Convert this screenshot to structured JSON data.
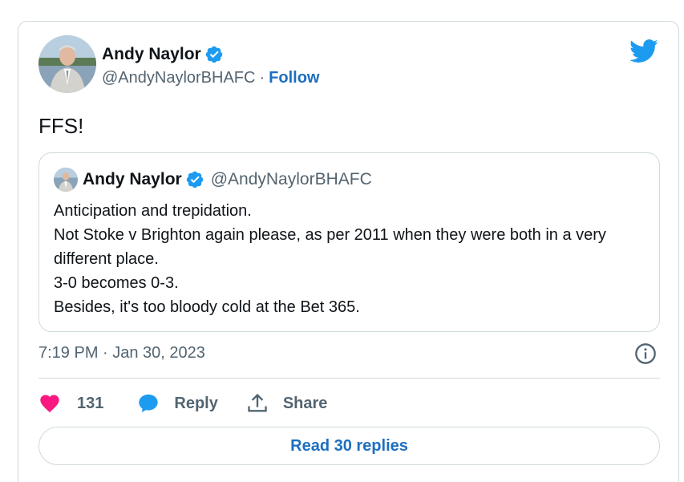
{
  "author": {
    "name": "Andy Naylor",
    "handle": "@AndyNaylorBHAFC",
    "separator": "·",
    "follow_label": "Follow"
  },
  "tweet": {
    "text": "FFS!",
    "timestamp": "7:19 PM · Jan 30, 2023"
  },
  "quoted_tweet": {
    "name": "Andy Naylor",
    "handle": "@AndyNaylorBHAFC",
    "lines": [
      "Anticipation and trepidation.",
      "Not Stoke v Brighton again please, as per 2011 when they were both in a very different place.",
      "3-0 becomes 0-3.",
      "Besides, it's too bloody cold at the Bet 365."
    ]
  },
  "actions": {
    "like_count": "131",
    "reply_label": "Reply",
    "share_label": "Share"
  },
  "read_replies_label": "Read 30 replies",
  "colors": {
    "accent": "#1d9bf0",
    "link": "#1d6fbf",
    "like": "#f91880",
    "secondary_text": "#536471",
    "border": "#cfd9de"
  },
  "icons": [
    "verified-badge-icon",
    "twitter-bird-icon",
    "info-icon",
    "heart-icon",
    "reply-bubble-icon",
    "share-icon"
  ]
}
